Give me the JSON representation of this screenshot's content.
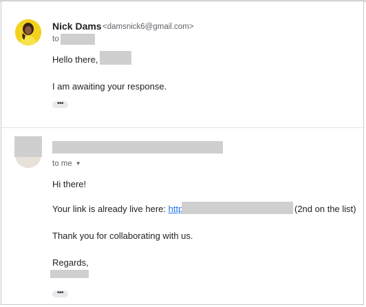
{
  "message1": {
    "sender_name": "Nick Dams",
    "sender_email": "<damsnick6@gmail.com>",
    "to_prefix": "to",
    "greeting": "Hello there,",
    "body": "I am awaiting your response.",
    "ellipsis": "•••"
  },
  "message2": {
    "to_label": "to me",
    "chevron": "▼",
    "greeting": "Hi there!",
    "link_intro": "Your link is already live here: ",
    "link_visible": "http",
    "link_suffix": "(2nd on the list)",
    "thanks": "Thank you for collaborating with us.",
    "regards": "Regards,",
    "ellipsis": "•••"
  },
  "colors": {
    "link": "#1a73e8",
    "redaction": "#cfcfcf"
  }
}
